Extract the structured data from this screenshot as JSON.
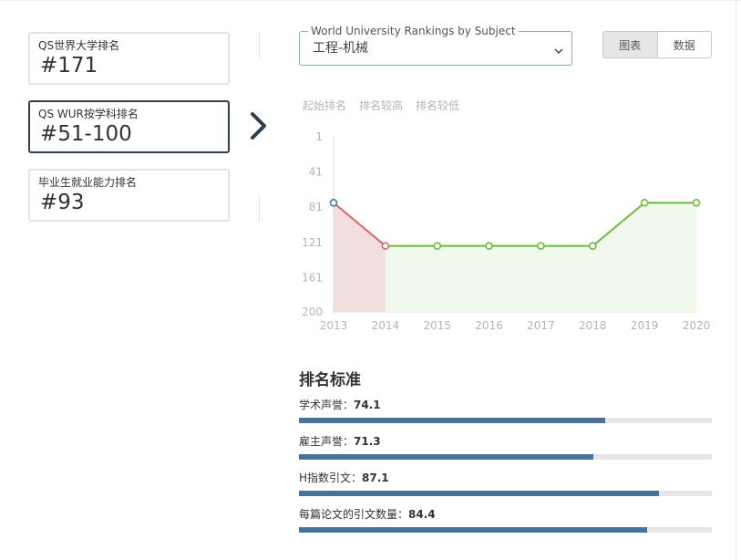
{
  "rankings": [
    {
      "label": "QS世界大学排名",
      "value": "#171",
      "active": false
    },
    {
      "label": "QS WUR按学科排名",
      "value": "#51-100",
      "active": true
    },
    {
      "label": "毕业生就业能力排名",
      "value": "#93",
      "active": false
    }
  ],
  "subject_select": {
    "legend": "World University Rankings by Subject",
    "value": "工程-机械"
  },
  "view_toggle": {
    "chart_label": "图表",
    "data_label": "数据",
    "selected": "chart"
  },
  "chart_legend": [
    "起始排名",
    "排名较高",
    "排名较低"
  ],
  "chart_data": {
    "type": "line",
    "x": [
      2013,
      2014,
      2015,
      2016,
      2017,
      2018,
      2019,
      2020
    ],
    "y": [
      76,
      125,
      125,
      125,
      125,
      125,
      76,
      76
    ],
    "y_axis_ticks": [
      1,
      41,
      81,
      121,
      161,
      200
    ],
    "ylim": [
      1,
      200
    ],
    "y_inverted": true,
    "x_tick_labels": [
      "2013",
      "2014",
      "2015",
      "2016",
      "2017",
      "2018",
      "2019",
      "2020"
    ],
    "colors": {
      "decline_line": "#d46a6a",
      "decline_fill": "#f2dede",
      "rise_line": "#6dbb3c",
      "rise_fill": "#f1f9ec",
      "first_point": "#3f7aa3"
    }
  },
  "criteria": {
    "title": "排名标准",
    "items": [
      {
        "label": "学术声誉：",
        "value": "74.1",
        "score": 74.1
      },
      {
        "label": "雇主声誉：",
        "value": "71.3",
        "score": 71.3
      },
      {
        "label": "H指数引文：",
        "value": "87.1",
        "score": 87.1
      },
      {
        "label": "每篇论文的引文数量：",
        "value": "84.4",
        "score": 84.4
      }
    ],
    "bar_color": "#4a7399"
  }
}
